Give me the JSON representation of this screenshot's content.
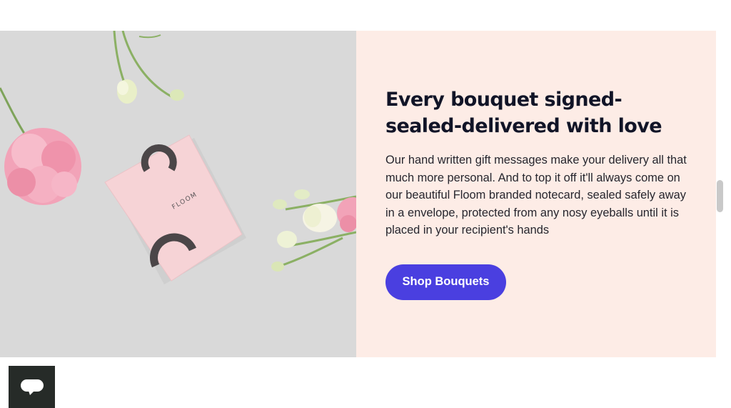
{
  "feature": {
    "headline": "Every bouquet signed-sealed-delivered with love",
    "body": "Our hand written gift messages make your delivery all that much more personal. And to top it off it'll always come on our beautiful Floom branded notecard, sealed safely away in a envelope, protected from any nosy eyeballs until it is placed in your recipient's hands",
    "cta_label": "Shop Bouquets",
    "image": {
      "card_brand": "FLOOM"
    }
  },
  "chat": {
    "icon": "chat-bubble-icon"
  },
  "colors": {
    "panel_bg": "#fdece6",
    "cta_bg": "#4a3fe0",
    "headline": "#111427",
    "chat_bg": "#262b28"
  }
}
